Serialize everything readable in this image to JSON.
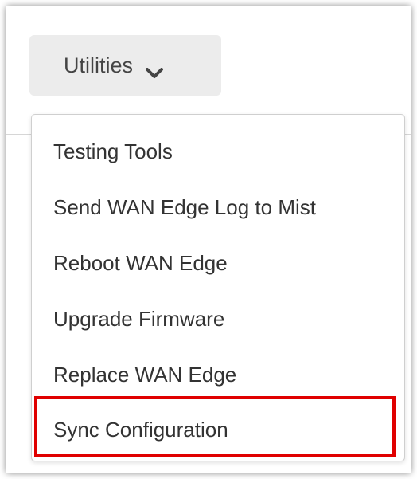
{
  "utilities_button": {
    "label": "Utilities",
    "icon": "chevron-down-icon"
  },
  "menu": {
    "items": [
      {
        "label": "Testing Tools"
      },
      {
        "label": "Send WAN Edge Log to Mist"
      },
      {
        "label": "Reboot WAN Edge"
      },
      {
        "label": "Upgrade Firmware"
      },
      {
        "label": "Replace WAN Edge"
      },
      {
        "label": "Sync Configuration"
      }
    ]
  },
  "highlight": {
    "color": "#e00000",
    "target": "Sync Configuration"
  }
}
